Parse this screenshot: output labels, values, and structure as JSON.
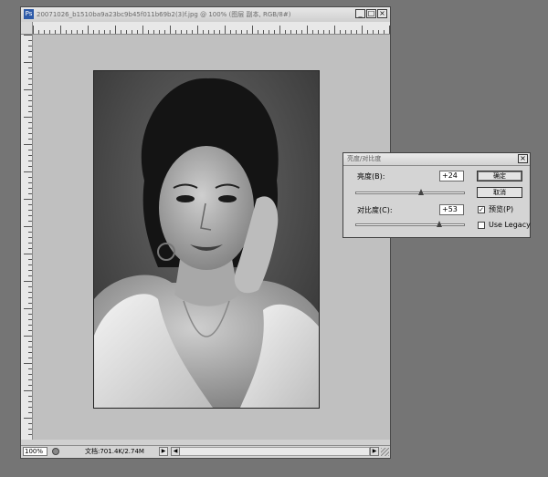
{
  "document": {
    "title": "20071026_b1510ba9a23bc9b45f011b69b2(3)f.jpg @ 100% (图层 副本, RGB/8#)",
    "app_icon": "photoshop-icon",
    "window_buttons": {
      "minimize": "_",
      "maximize": "□",
      "close": "×"
    },
    "zoom": "100%",
    "size_info": "文档:701.4K/2.74M",
    "status_arrow": "▶",
    "scroll_left": "◀",
    "scroll_right": "▶"
  },
  "dialog": {
    "title": "亮度/对比度",
    "close": "×",
    "brightness_label": "亮度(B):",
    "brightness_value": "+24",
    "brightness_level_fraction": 0.6,
    "contrast_label": "对比度(C):",
    "contrast_value": "+53",
    "contrast_level_fraction": 0.77,
    "ok_label": "确定",
    "cancel_label": "取消",
    "preview_label": "预览(P)",
    "preview_checked": true,
    "legacy_label": "Use Legacy",
    "legacy_checked": false,
    "check_mark": "✓"
  },
  "colors": {
    "workspace": "#757575",
    "canvas": "#c0c0c0",
    "dialog": "#d4d4d4"
  }
}
